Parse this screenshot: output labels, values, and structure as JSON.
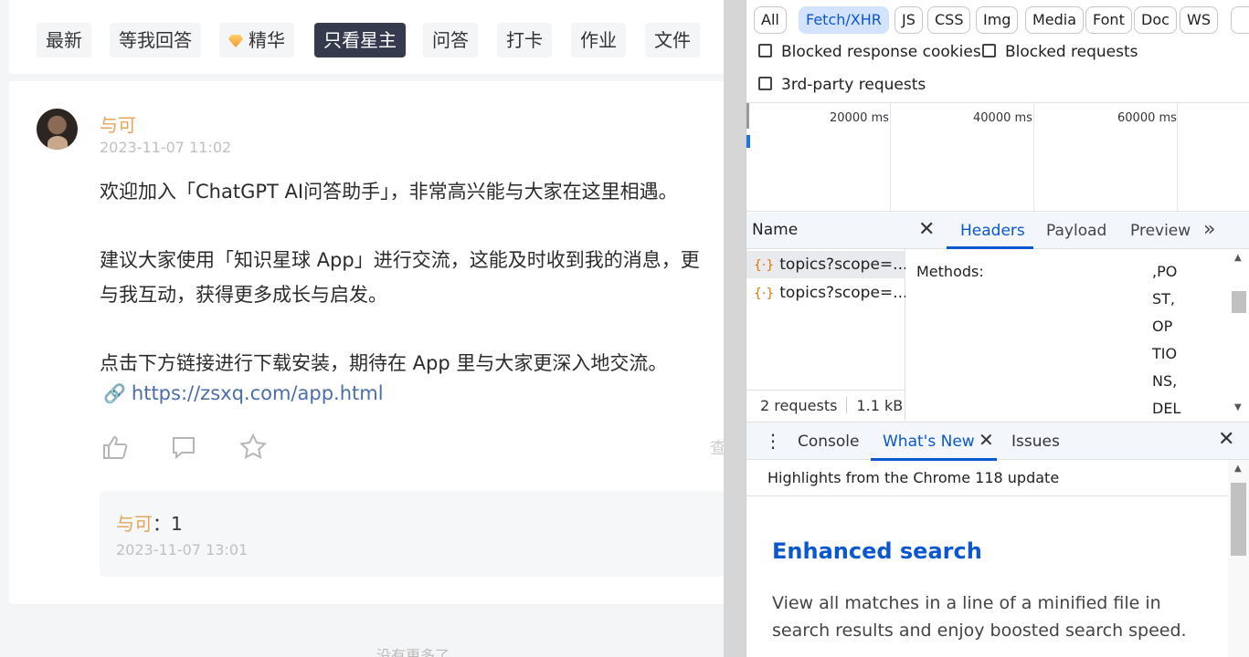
{
  "filters": [
    {
      "label": "最新"
    },
    {
      "label": "等我回答"
    },
    {
      "label": "精华"
    },
    {
      "label": "只看星主",
      "active": true
    },
    {
      "label": "问答"
    },
    {
      "label": "打卡"
    },
    {
      "label": "作业"
    },
    {
      "label": "文件"
    }
  ],
  "post": {
    "author": "与可",
    "time": "2023-11-07 11:02",
    "lines": [
      "欢迎加入「ChatGPT AI问答助手」，非常高兴能与大家在这里相遇。",
      "建议大家使用「知识星球 App」进行交流，这能及时收到我的消息，更",
      "与我互动，获得更多成长与启发。",
      "点击下方链接进行下载安装，期待在 App 里与大家更深入地交流。"
    ],
    "link": "https://zsxq.com/app.html",
    "cut_text": "查",
    "comment": {
      "author": "与可",
      "colon": "：",
      "text": "1",
      "time": "2023-11-07 13:01"
    },
    "no_more": "没有更多了"
  },
  "devtools": {
    "type_filters": [
      "All",
      "Fetch/XHR",
      "JS",
      "CSS",
      "Img",
      "Media",
      "Font",
      "Doc",
      "WS"
    ],
    "active_type": "Fetch/XHR",
    "checkboxes": [
      "Blocked response cookies",
      "Blocked requests",
      "3rd-party requests"
    ],
    "timeline_labels": [
      "20000 ms",
      "40000 ms",
      "60000 ms"
    ],
    "name_header": "Name",
    "requests": [
      "topics?scope=...",
      "topics?scope=..."
    ],
    "footer_requests": "2 requests",
    "footer_size": "1.1 kB",
    "detail_tabs": [
      "Headers",
      "Payload",
      "Preview"
    ],
    "detail_more": "»",
    "methods_label": "Methods:",
    "methods_value_lines": [
      ",PO",
      "ST,",
      "OP",
      "TIO",
      "NS,",
      "DEL"
    ],
    "drawer_tabs": [
      "Console",
      "What's New",
      "Issues"
    ],
    "active_drawer_tab": "What's New",
    "whats_new_header": "Highlights from the Chrome 118 update",
    "whats_new_title": "Enhanced search",
    "whats_new_body": "View all matches in a line of a minified file in search results and enjoy boosted search speed."
  },
  "colors": {
    "accent_blue": "#0b57d0",
    "author_orange": "#e3a65b",
    "active_chip": "#353b4d"
  }
}
